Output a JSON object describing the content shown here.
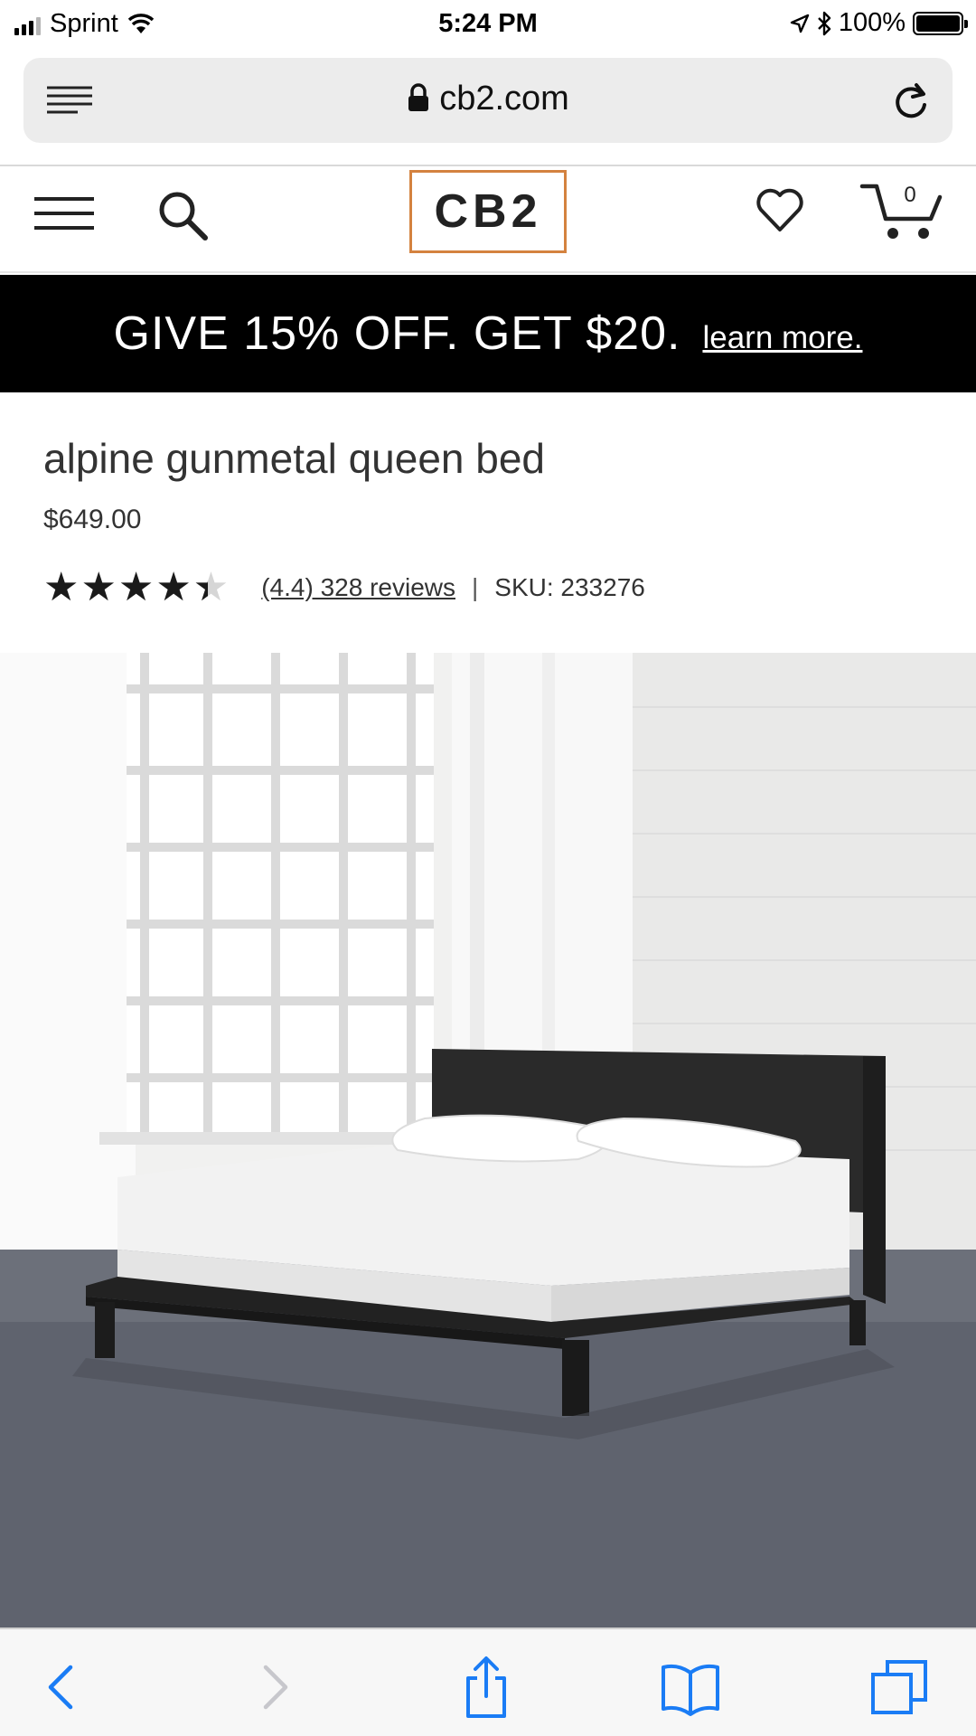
{
  "status_bar": {
    "carrier": "Sprint",
    "time": "5:24 PM",
    "battery": "100%",
    "icons": [
      "signal-icon",
      "wifi-icon",
      "location-icon",
      "bluetooth-icon",
      "battery-icon"
    ]
  },
  "browser": {
    "url": "cb2.com",
    "icons": [
      "reader-icon",
      "lock-icon",
      "reload-icon"
    ]
  },
  "site_header": {
    "logo": "CB2",
    "cart_count": "0",
    "accent_color": "#d4823f",
    "icons": [
      "menu-icon",
      "search-icon",
      "heart-icon",
      "cart-icon"
    ]
  },
  "promo": {
    "text": "GIVE 15% OFF. GET $20.",
    "link": "learn more.",
    "background": "#000000"
  },
  "product": {
    "title": "alpine gunmetal queen bed",
    "price": "$649.00",
    "rating_stars": 4.4,
    "reviews_link": "(4.4) 328 reviews",
    "separator": "|",
    "sku": "SKU: 233276"
  },
  "toolbar": {
    "icons": [
      "back-icon",
      "forward-icon",
      "share-icon",
      "bookmarks-icon",
      "tabs-icon"
    ],
    "active_color": "#1a7cf5",
    "disabled_color": "#c7c7cc"
  }
}
